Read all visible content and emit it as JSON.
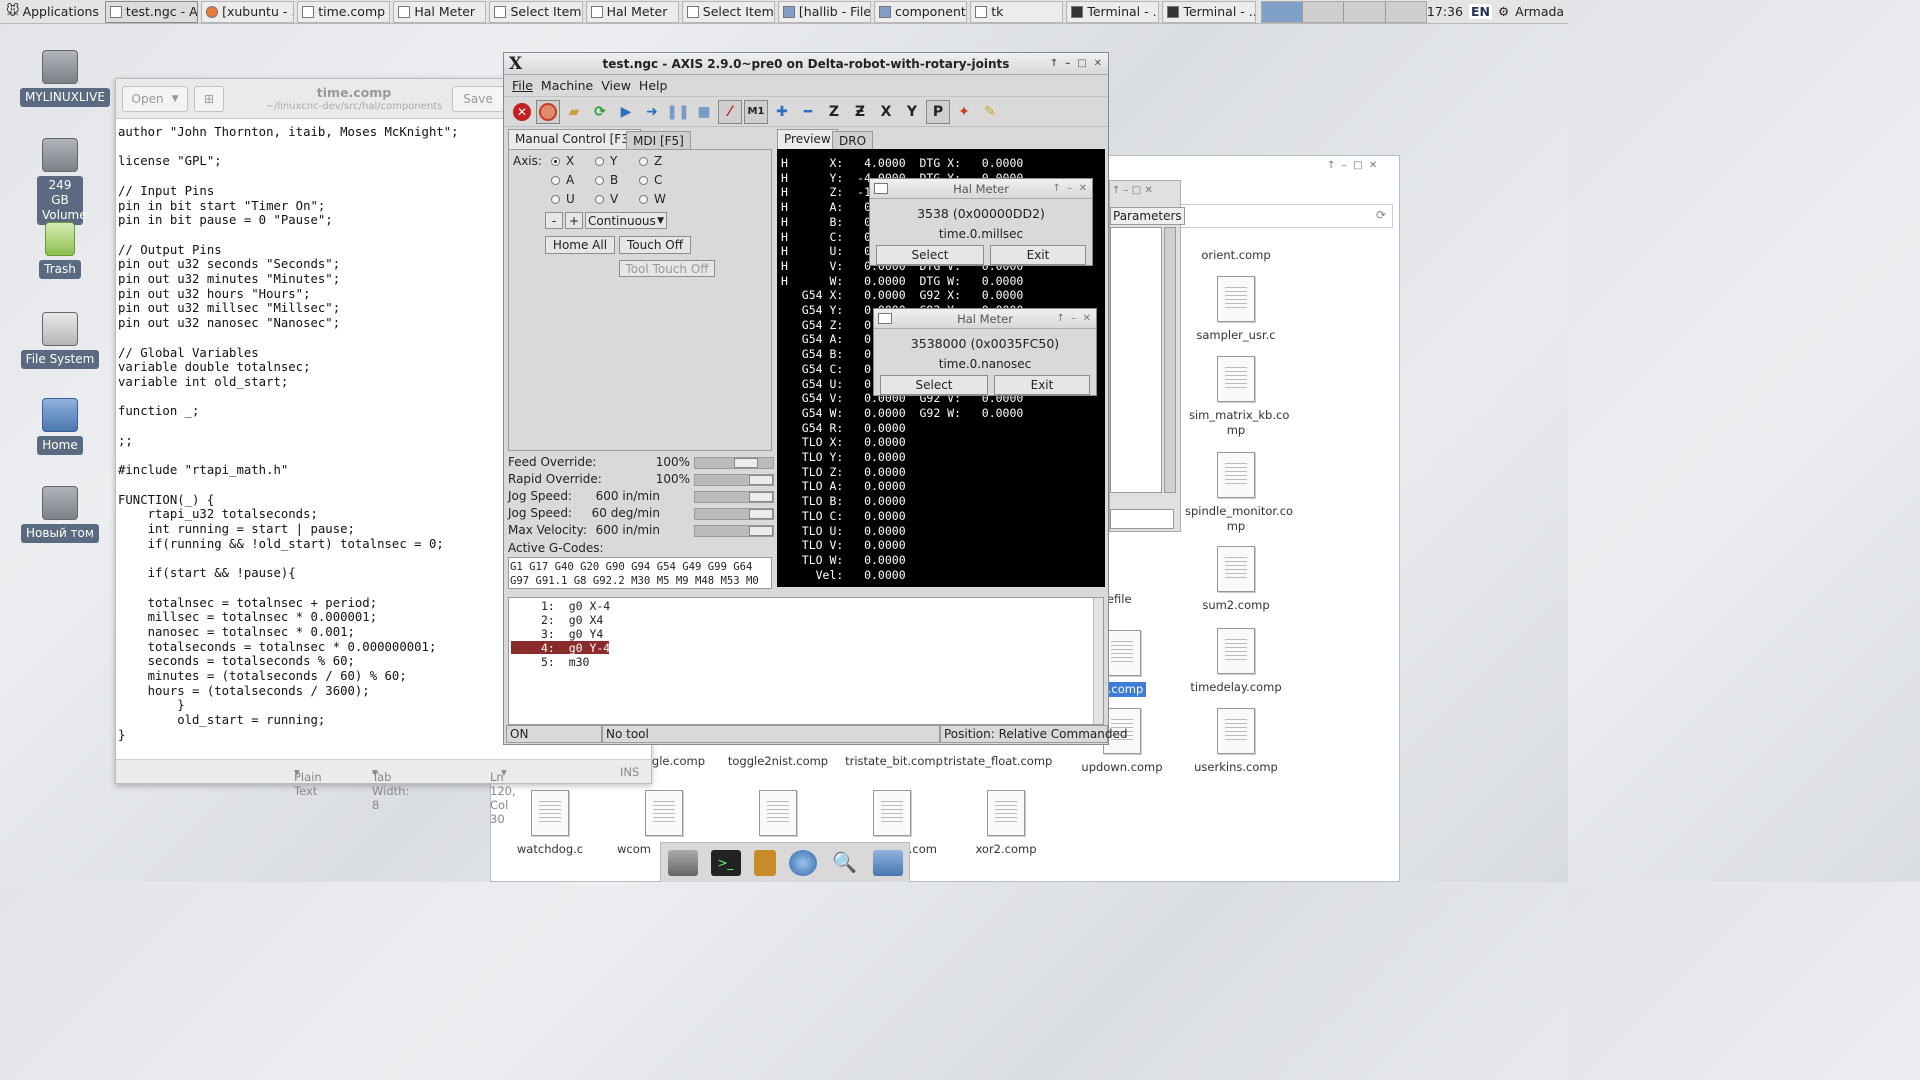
{
  "taskbar": {
    "apps_label": "Applications",
    "tasks": [
      "test.ngc - A...",
      "[xubuntu - ...",
      "time.comp ...",
      "Hal Meter",
      "Select Item...",
      "Hal Meter",
      "Select Item...",
      "[hallib - File...",
      "component...",
      "tk",
      "Terminal - ...",
      "Terminal - ..."
    ],
    "clock": "17:36",
    "lang": "EN",
    "user": "Armada"
  },
  "desktop": {
    "icons": [
      "MYLINUXLIVE",
      "249 GB Volume",
      "Trash",
      "File System",
      "Home",
      "Новый том"
    ]
  },
  "editor": {
    "title": "time.comp",
    "path": "~/linuxcnc-dev/src/hal/components",
    "open_label": "Open",
    "save_label": "Save",
    "code": "author \"John Thornton, itaib, Moses McKnight\";\n\nlicense \"GPL\";\n\n// Input Pins\npin in bit start \"Timer On\";\npin in bit pause = 0 \"Pause\";\n\n// Output Pins\npin out u32 seconds \"Seconds\";\npin out u32 minutes \"Minutes\";\npin out u32 hours \"Hours\";\npin out u32 millsec \"Millsec\";\npin out u32 nanosec \"Nanosec\";\n\n// Global Variables\nvariable double totalnsec;\nvariable int old_start;\n\nfunction _;\n\n;;\n\n#include \"rtapi_math.h\"\n\nFUNCTION(_) {\n    rtapi_u32 totalseconds;\n    int running = start | pause;\n    if(running && !old_start) totalnsec = 0;\n\n    if(start && !pause){\n\n    totalnsec = totalnsec + period;\n    millsec = totalnsec * 0.000001;\n    nanosec = totalnsec * 0.001;\n    totalseconds = totalnsec * 0.000000001;\n    seconds = totalseconds % 60;\n    minutes = (totalseconds / 60) % 60;\n    hours = (totalseconds / 3600);\n        }\n        old_start = running;\n}",
    "status": {
      "lang": "Plain Text",
      "tab": "Tab Width: 8",
      "pos": "Ln 120, Col 30",
      "mode": "INS"
    }
  },
  "axis": {
    "title": "test.ngc - AXIS 2.9.0~pre0 on Delta-robot-with-rotary-joints",
    "menu": [
      "File",
      "Machine",
      "View",
      "Help"
    ],
    "tabs": {
      "manual": "Manual Control [F3]",
      "mdi": "MDI [F5]",
      "preview": "Preview",
      "dro": "DRO"
    },
    "axis_label": "Axis:",
    "axes": [
      "X",
      "Y",
      "Z",
      "A",
      "B",
      "C",
      "U",
      "V",
      "W"
    ],
    "jog": {
      "minus": "-",
      "plus": "+",
      "mode": "Continuous"
    },
    "buttons": {
      "home_all": "Home All",
      "touch_off": "Touch Off",
      "tool_touch_off": "Tool Touch Off"
    },
    "overrides": [
      {
        "label": "Feed Override:",
        "value": "100%",
        "level": 0.72
      },
      {
        "label": "Rapid Override:",
        "value": "100%",
        "level": 1.0
      },
      {
        "label": "Jog Speed:",
        "value": "600 in/min",
        "level": 1.0
      },
      {
        "label": "Jog Speed:",
        "value": "60 deg/min",
        "level": 1.0
      },
      {
        "label": "Max Velocity:",
        "value": "600 in/min",
        "level": 1.0
      }
    ],
    "active_gcodes_label": "Active G-Codes:",
    "active_gcodes": [
      "G1 G17 G40 G20 G90 G94 G54 G49 G99 G64",
      "G97 G91.1 G8 G92.2 M30 M5 M9 M48 M53 M0"
    ],
    "preview_text": "H      X:   4.0000  DTG X:   0.0000\nH      Y:  -4.0000  DTG Y:   0.0000\nH      Z:  -1.0000  DTG Z:   0.0000\nH      A:   0.0000  DTG A:   0.0000\nH      B:   0.0000  DTG B:   0.0000\nH      C:   0.0000  DTG C:   0.0000\nH      U:   0.0000  DTG U:   0.0000\nH      V:   0.0000  DTG V:   0.0000\nH      W:   0.0000  DTG W:   0.0000\n   G54 X:   0.0000  G92 X:   0.0000\n   G54 Y:   0.0000  G92 Y:   0.0000\n   G54 Z:   0.0000  G92 Z:   0.0000\n   G54 A:   0.0000  G92 A:   0.0000\n   G54 B:   0.0000  G92 B:   0.0000\n   G54 C:   0.0000  G92 C:   0.0000\n   G54 U:   0.0000  G92 U:   0.0000\n   G54 V:   0.0000  G92 V:   0.0000\n   G54 W:   0.0000  G92 W:   0.0000\n   G54 R:   0.0000\n   TLO X:   0.0000\n   TLO Y:   0.0000\n   TLO Z:   0.0000\n   TLO A:   0.0000\n   TLO B:   0.0000\n   TLO C:   0.0000\n   TLO U:   0.0000\n   TLO V:   0.0000\n   TLO W:   0.0000\n     Vel:   0.0000",
    "gcode_lines": [
      "1:  g0 X-4",
      "2:  g0 X4",
      "3:  g0 Y4",
      "4:  g0 Y-4",
      "5:  m30"
    ],
    "status": {
      "state": "ON",
      "tool": "No tool",
      "position": "Position: Relative Commanded"
    }
  },
  "hal_meters": [
    {
      "title": "Hal Meter",
      "value": "3538 (0x00000DD2)",
      "pin": "time.0.millsec",
      "select": "Select",
      "exit": "Exit"
    },
    {
      "title": "Hal Meter",
      "value": "3538000 (0x0035FC50)",
      "pin": "time.0.nanosec",
      "select": "Select",
      "exit": "Exit"
    }
  ],
  "filemanager": {
    "partial_tab": "Parameters",
    "files": [
      "orient.comp",
      "sampler_usr.c",
      "sim_matrix_kb.co mp",
      "spindle_monitor.co mp",
      "sum2.comp",
      "timedelay.comp",
      "userkins.comp",
      "updown.comp",
      "tristate_float.comp",
      "tristate_bit.comp",
      "toggle2nist.comp",
      "gle.comp",
      "makefile",
      "e.comp",
      "watchdog.c",
      "wcom",
      "il.com",
      "xor2.comp"
    ]
  }
}
